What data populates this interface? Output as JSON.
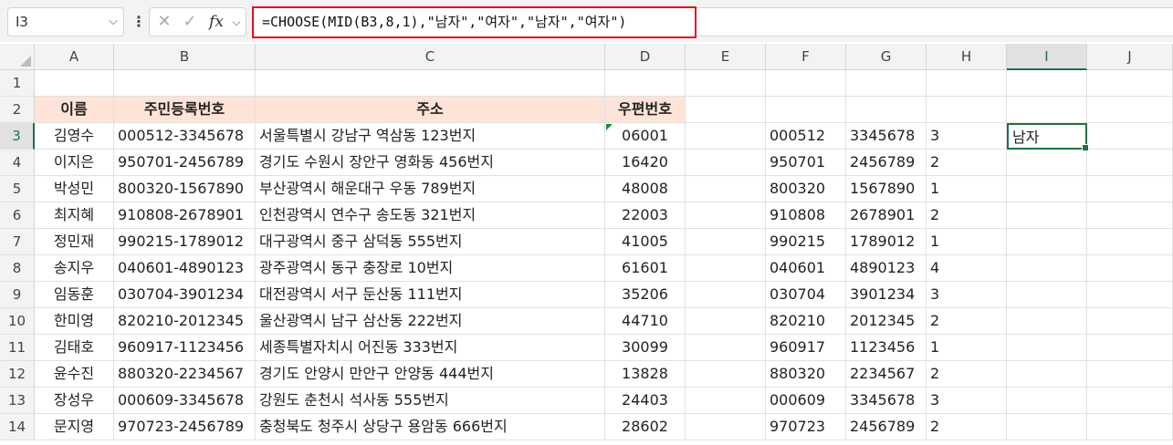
{
  "formula_bar": {
    "name_box": "I3",
    "formula": "=CHOOSE(MID(B3,8,1),\"남자\",\"여자\",\"남자\",\"여자\")",
    "fx_label": "fx"
  },
  "columns": [
    "A",
    "B",
    "C",
    "D",
    "E",
    "F",
    "G",
    "H",
    "I",
    "J"
  ],
  "selected_column": "I",
  "rows": [
    "1",
    "2",
    "3",
    "4",
    "5",
    "6",
    "7",
    "8",
    "9",
    "10",
    "11",
    "12",
    "13",
    "14"
  ],
  "selected_row": "3",
  "headers": {
    "name": "이름",
    "rrn": "주민등록번호",
    "address": "주소",
    "zip": "우편번호"
  },
  "records": [
    {
      "name": "김영수",
      "rrn": "000512-3345678",
      "address": "서울특별시 강남구 역삼동 123번지",
      "zip": "06001",
      "f": "000512",
      "g": "3345678",
      "h": "3",
      "i": "남자"
    },
    {
      "name": "이지은",
      "rrn": "950701-2456789",
      "address": "경기도 수원시 장안구 영화동 456번지",
      "zip": "16420",
      "f": "950701",
      "g": "2456789",
      "h": "2",
      "i": ""
    },
    {
      "name": "박성민",
      "rrn": "800320-1567890",
      "address": "부산광역시 해운대구 우동 789번지",
      "zip": "48008",
      "f": "800320",
      "g": "1567890",
      "h": "1",
      "i": ""
    },
    {
      "name": "최지혜",
      "rrn": "910808-2678901",
      "address": "인천광역시 연수구 송도동 321번지",
      "zip": "22003",
      "f": "910808",
      "g": "2678901",
      "h": "2",
      "i": ""
    },
    {
      "name": "정민재",
      "rrn": "990215-1789012",
      "address": "대구광역시 중구 삼덕동 555번지",
      "zip": "41005",
      "f": "990215",
      "g": "1789012",
      "h": "1",
      "i": ""
    },
    {
      "name": "송지우",
      "rrn": "040601-4890123",
      "address": "광주광역시 동구 충장로 10번지",
      "zip": "61601",
      "f": "040601",
      "g": "4890123",
      "h": "4",
      "i": ""
    },
    {
      "name": "임동훈",
      "rrn": "030704-3901234",
      "address": "대전광역시 서구 둔산동 111번지",
      "zip": "35206",
      "f": "030704",
      "g": "3901234",
      "h": "3",
      "i": ""
    },
    {
      "name": "한미영",
      "rrn": "820210-2012345",
      "address": "울산광역시 남구 삼산동 222번지",
      "zip": "44710",
      "f": "820210",
      "g": "2012345",
      "h": "2",
      "i": ""
    },
    {
      "name": "김태호",
      "rrn": "960917-1123456",
      "address": "세종특별자치시 어진동 333번지",
      "zip": "30099",
      "f": "960917",
      "g": "1123456",
      "h": "1",
      "i": ""
    },
    {
      "name": "윤수진",
      "rrn": "880320-2234567",
      "address": "경기도 안양시 만안구 안양동 444번지",
      "zip": "13828",
      "f": "880320",
      "g": "2234567",
      "h": "2",
      "i": ""
    },
    {
      "name": "장성우",
      "rrn": "000609-3345678",
      "address": "강원도 춘천시 석사동 555번지",
      "zip": "24403",
      "f": "000609",
      "g": "3345678",
      "h": "3",
      "i": ""
    },
    {
      "name": "문지영",
      "rrn": "970723-2456789",
      "address": "충청북도 청주시 상당구 용암동 666번지",
      "zip": "28602",
      "f": "970723",
      "g": "2456789",
      "h": "2",
      "i": ""
    }
  ],
  "colors": {
    "header_fill": "#fde4d6",
    "selection": "#1e7145",
    "formula_highlight": "#e3111b"
  }
}
